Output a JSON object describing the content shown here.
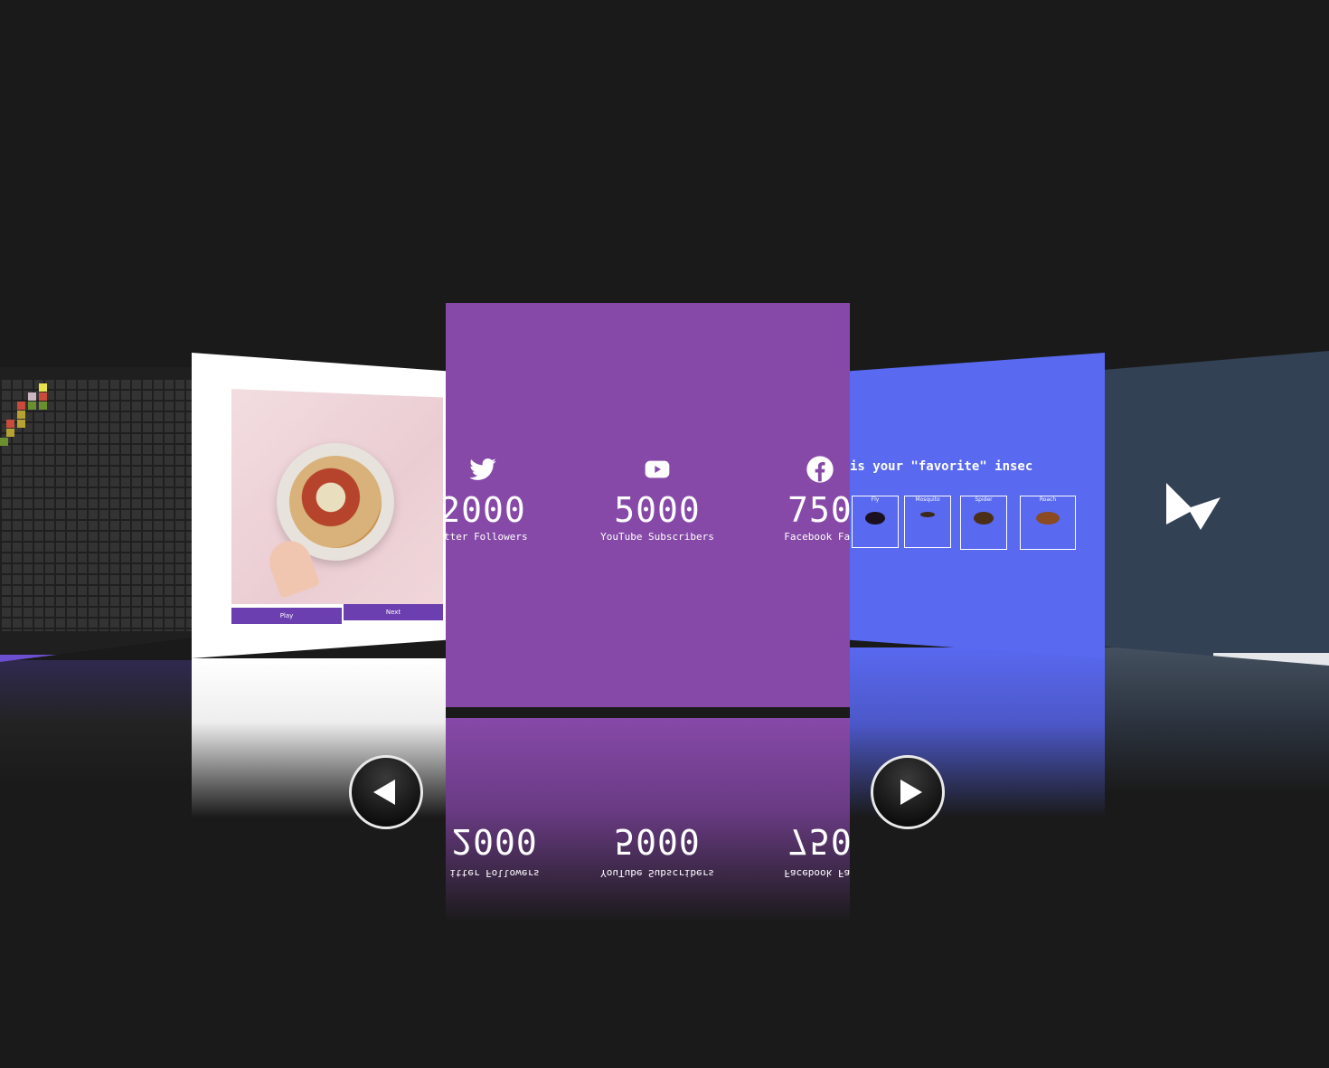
{
  "carousel": {
    "pizza_card": {
      "buttons": [
        "Play",
        "Next"
      ]
    },
    "social_card": {
      "stats": [
        {
          "icon": "twitter-icon",
          "number": "2000",
          "label": "itter Followers"
        },
        {
          "icon": "youtube-icon",
          "number": "5000",
          "label": "YouTube Subscribers"
        },
        {
          "icon": "facebook-icon",
          "number": "750",
          "label": "Facebook Fan"
        }
      ]
    },
    "insect_card": {
      "title": "is your \"favorite\" insec",
      "options": [
        "Fly",
        "Mosquito",
        "Spider",
        "Roach"
      ]
    },
    "dark_card": {
      "logo": "bowtie-logo-icon"
    }
  },
  "navigation": {
    "prev_icon": "chevron-left-icon",
    "next_icon": "chevron-right-icon"
  },
  "colors": {
    "background": "#1a1a1a",
    "social_card": "#8649a8",
    "insect_card": "#5969f0",
    "dark_card": "#334155",
    "accent_purple": "#6b3fb0"
  }
}
